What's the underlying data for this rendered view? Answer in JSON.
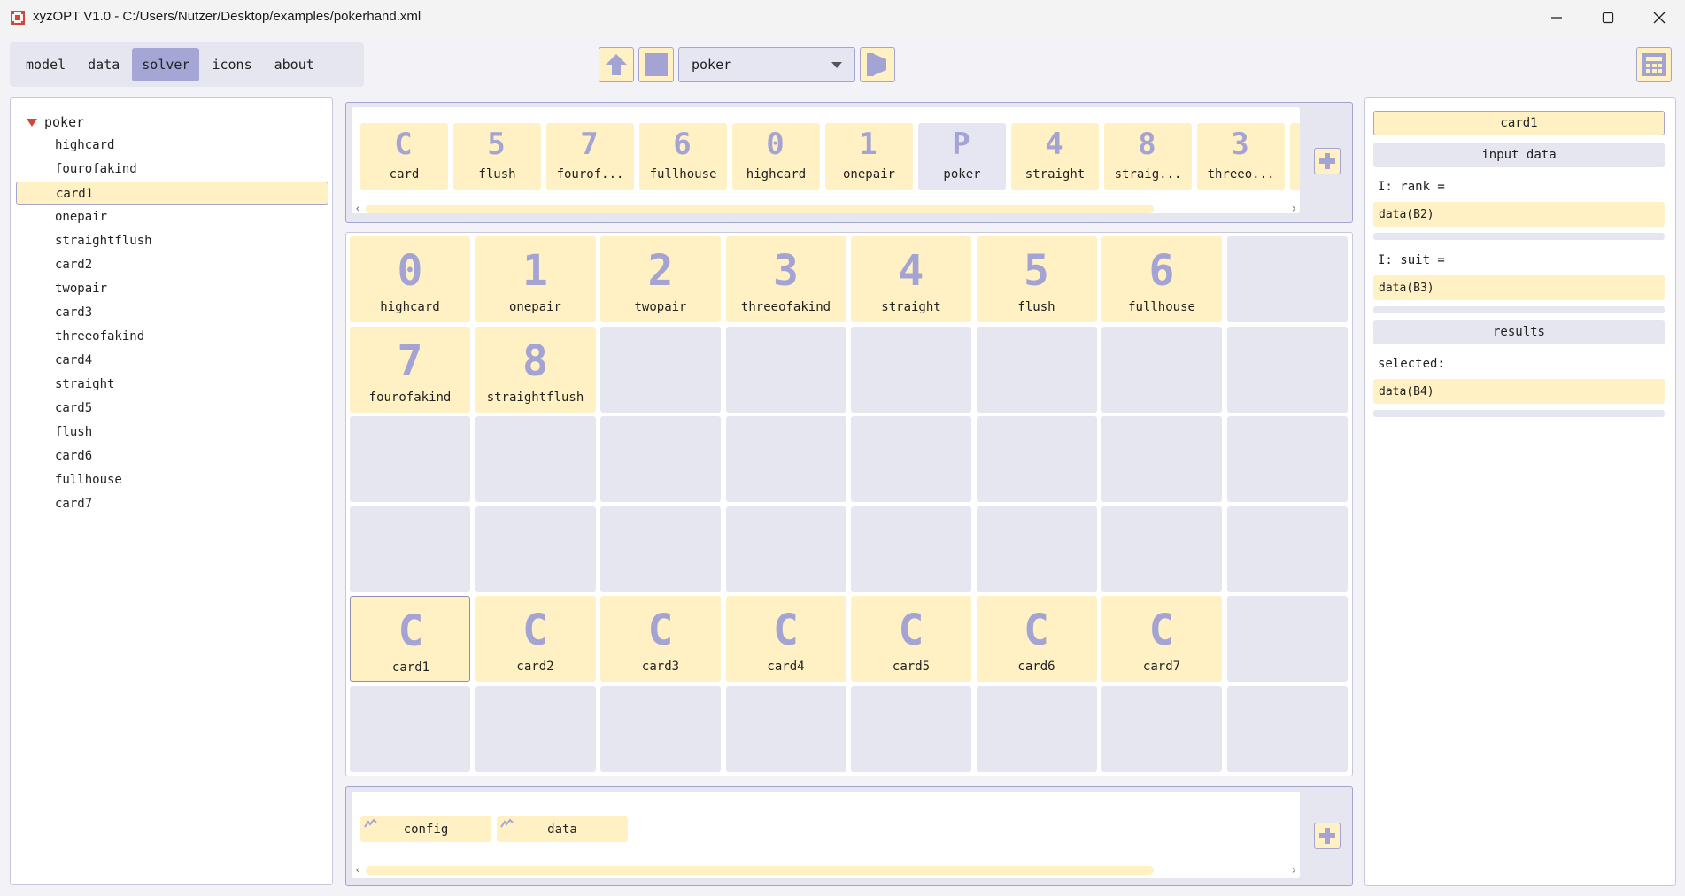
{
  "window": {
    "title": "xyzOPT V1.0 - C:/Users/Nutzer/Desktop/examples/pokerhand.xml"
  },
  "menu": {
    "tabs": [
      {
        "label": "model"
      },
      {
        "label": "data"
      },
      {
        "label": "solver",
        "active": true
      },
      {
        "label": "icons"
      },
      {
        "label": "about"
      }
    ]
  },
  "toolbar": {
    "solver_selected": "poker"
  },
  "tree": {
    "root": "poker",
    "items": [
      "highcard",
      "fourofakind",
      "card1",
      "onepair",
      "straightflush",
      "card2",
      "twopair",
      "card3",
      "threeofakind",
      "card4",
      "straight",
      "card5",
      "flush",
      "card6",
      "fullhouse",
      "card7"
    ],
    "selected": "card1"
  },
  "top_strip": {
    "items": [
      {
        "glyph": "C",
        "label": "card"
      },
      {
        "glyph": "5",
        "label": "flush"
      },
      {
        "glyph": "7",
        "label": "fourof..."
      },
      {
        "glyph": "6",
        "label": "fullhouse"
      },
      {
        "glyph": "0",
        "label": "highcard"
      },
      {
        "glyph": "1",
        "label": "onepair"
      },
      {
        "glyph": "P",
        "label": "poker"
      },
      {
        "glyph": "4",
        "label": "straight"
      },
      {
        "glyph": "8",
        "label": "straig..."
      },
      {
        "glyph": "3",
        "label": "threeo..."
      }
    ]
  },
  "grid": {
    "rows": [
      [
        {
          "glyph": "0",
          "label": "highcard"
        },
        {
          "glyph": "1",
          "label": "onepair"
        },
        {
          "glyph": "2",
          "label": "twopair"
        },
        {
          "glyph": "3",
          "label": "threeofakind"
        },
        {
          "glyph": "4",
          "label": "straight"
        },
        {
          "glyph": "5",
          "label": "flush"
        },
        {
          "glyph": "6",
          "label": "fullhouse"
        },
        null
      ],
      [
        {
          "glyph": "7",
          "label": "fourofakind"
        },
        {
          "glyph": "8",
          "label": "straightflush"
        },
        null,
        null,
        null,
        null,
        null,
        null
      ],
      [
        null,
        null,
        null,
        null,
        null,
        null,
        null,
        null
      ],
      [
        null,
        null,
        null,
        null,
        null,
        null,
        null,
        null
      ],
      [
        {
          "glyph": "C",
          "label": "card1"
        },
        {
          "glyph": "C",
          "label": "card2"
        },
        {
          "glyph": "C",
          "label": "card3"
        },
        {
          "glyph": "C",
          "label": "card4"
        },
        {
          "glyph": "C",
          "label": "card5"
        },
        {
          "glyph": "C",
          "label": "card6"
        },
        {
          "glyph": "C",
          "label": "card7"
        },
        null
      ],
      [
        null,
        null,
        null,
        null,
        null,
        null,
        null,
        null
      ]
    ]
  },
  "bottom_strip": {
    "tabs": [
      {
        "label": "config"
      },
      {
        "label": "data"
      }
    ]
  },
  "props": {
    "header": "card1",
    "input_section": "input data",
    "rank_label": "I: rank =",
    "rank_value": "data(B2)",
    "suit_label": "I: suit =",
    "suit_value": "data(B3)",
    "results_section": "results",
    "selected_label": "selected:",
    "selected_value": "data(B4)"
  },
  "colors": {
    "accent": "#a5a5d6",
    "item_fill": "#fff1c4",
    "empty_cell": "#e6e6f0",
    "glyph": "#a4a4d4",
    "tree_marker": "#d6453a"
  }
}
